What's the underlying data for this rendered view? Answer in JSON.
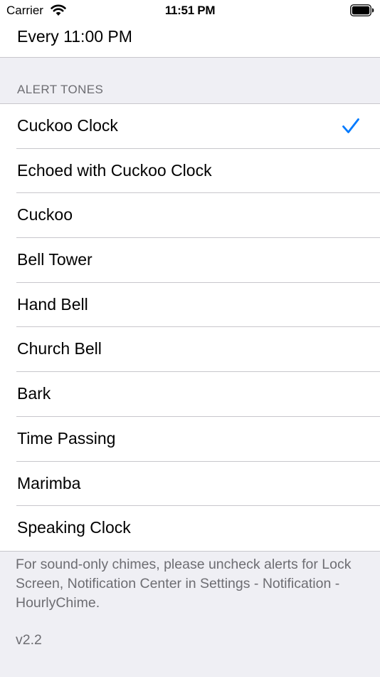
{
  "status_bar": {
    "carrier": "Carrier",
    "time": "11:51 PM",
    "wifi_icon": "wifi-icon",
    "battery_icon": "battery-icon"
  },
  "top_cell": {
    "label": "Every 11:00 PM"
  },
  "alert_tones": {
    "header": "ALERT TONES",
    "selected": "Cuckoo Clock",
    "check_icon": "checkmark-icon",
    "accent_color": "#007aff",
    "items": [
      {
        "label": "Cuckoo Clock"
      },
      {
        "label": "Echoed with Cuckoo Clock"
      },
      {
        "label": "Cuckoo"
      },
      {
        "label": "Bell Tower"
      },
      {
        "label": "Hand Bell"
      },
      {
        "label": "Church Bell"
      },
      {
        "label": "Bark"
      },
      {
        "label": "Time Passing"
      },
      {
        "label": "Marimba"
      },
      {
        "label": "Speaking Clock"
      }
    ]
  },
  "footer": {
    "note": "For sound-only chimes, please uncheck alerts for Lock Screen, Notification Center in Settings - Notification - HourlyChime.",
    "version": "v2.2"
  }
}
